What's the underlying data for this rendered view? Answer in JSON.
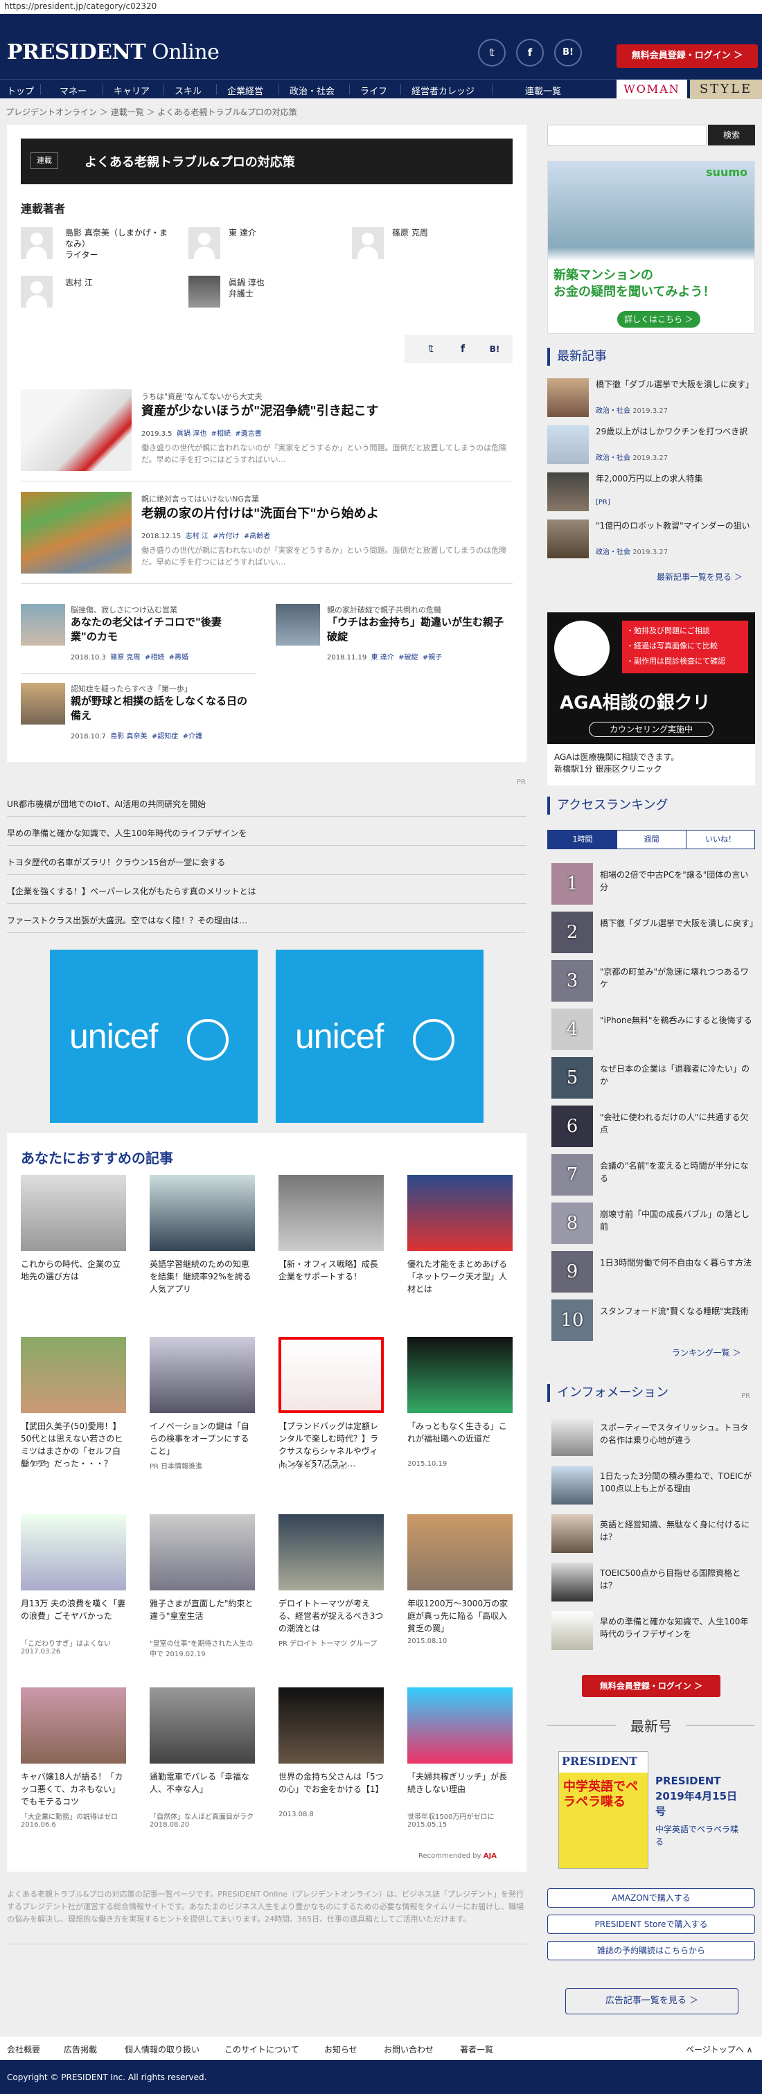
{
  "url": "https://president.jp/category/c02320",
  "header": {
    "logo_main": "PRESIDENT",
    "logo_sub": "Online",
    "social": [
      "twitter-icon",
      "facebook-icon",
      "hatena-icon"
    ],
    "social_labels": [
      "𝕥",
      "f",
      "B!"
    ],
    "register": "無料会員登録・ログイン ＞"
  },
  "nav": {
    "items": [
      "トップ",
      "マネー",
      "キャリア",
      "スキル",
      "企業経営",
      "政治・社会",
      "ライフ",
      "経営者カレッジ",
      "連載一覧"
    ],
    "woman": "WOMAN",
    "style": "STYLE"
  },
  "breadcrumb": [
    "プレジデントオンライン",
    "＞",
    "連載一覧",
    "＞",
    "よくある老親トラブル&プロの対応策"
  ],
  "page": {
    "tag": "連載",
    "title": "よくある老親トラブル&プロの対応策"
  },
  "authors_heading": "連載著者",
  "authors": [
    {
      "name": "島影 真奈美（しまかげ・まなみ）",
      "role": "ライター"
    },
    {
      "name": "東 達介",
      "role": ""
    },
    {
      "name": "篠原 克周",
      "role": ""
    },
    {
      "name": "志村 江",
      "role": ""
    },
    {
      "name": "眞鍋 淳也",
      "role": "弁護士"
    }
  ],
  "share": [
    "twitter-icon",
    "facebook-icon",
    "hatena-icon"
  ],
  "share_labels": [
    "𝕥",
    "f",
    "B!"
  ],
  "articles": [
    {
      "kicker": "うちは\"資産\"なんてないから大丈夫",
      "title": "資産が少ないほうが\"泥沼争続\"引き起こす",
      "date": "2019.3.5",
      "author": "眞鍋 淳也",
      "tags": [
        "#相続",
        "#遺言書"
      ],
      "excerpt": "働き盛りの世代が親に言われないのが「実家をどうするか」という問題。面倒だと放置してしまうのは危険だ。早めに手を打つにはどうすればいい…"
    },
    {
      "kicker": "親に絶対言ってはいけないNG言葉",
      "title": "老親の家の片付けは\"洗面台下\"から始めよ",
      "date": "2018.12.15",
      "author": "志村 江",
      "tags": [
        "#片付け",
        "#高齢者"
      ],
      "excerpt": "働き盛りの世代が親に言われないのが「実家をどうするか」という問題。面倒だと放置してしまうのは危険だ。早めに手を打つにはどうすればいい…"
    },
    {
      "kicker": "脳挫傷、寂しさにつけ込む営業",
      "title": "あなたの老父はイチコロで\"後妻業\"のカモ",
      "date": "2018.10.3",
      "author": "篠原 克周",
      "tags": [
        "#相続",
        "#再婚"
      ]
    },
    {
      "kicker": "親の家計破綻で親子共倒れの危機",
      "title": "「ウチはお金持ち」勘違いが生む親子破綻",
      "date": "2018.11.19",
      "author": "東 達介",
      "tags": [
        "#破綻",
        "#親子"
      ]
    },
    {
      "kicker": "認知症を疑ったらすべき「第一歩」",
      "title": "親が野球と相撲の話をしなくなる日の備え",
      "date": "2018.10.7",
      "author": "島影 真奈美",
      "tags": [
        "#認知症",
        "#介護"
      ]
    }
  ],
  "pr_label": "PR",
  "pr_links": [
    "UR都市機構が団地でのIoT、AI活用の共同研究を開始",
    "早めの準備と確かな知識で、人生100年時代のライフデザインを",
    "トヨタ歴代の名車がズラリ！クラウン15台が一堂に会する",
    "【企業を強くする！】ペーパーレス化がもたらす真のメリットとは",
    "ファーストクラス出張が大盛況。空ではなく陸！？その理由は…"
  ],
  "unicef": "unicef",
  "recommend": {
    "heading": "あなたにおすすめの記事",
    "footer": "Recommended by",
    "items": [
      {
        "title": "これからの時代、企業の立地先の選び方は",
        "sub": ""
      },
      {
        "title": "英語学習継続のための知恵を結集！継続率92%を誇る人気アプリ",
        "sub": ""
      },
      {
        "title": "【新・オフィス戦略】成長企業をサポートする！",
        "sub": ""
      },
      {
        "title": "優れた才能をまとめあげる「ネットワーク天才型」人材とは",
        "sub": ""
      },
      {
        "title": "【武田久美子(50)愛用！】50代とは思えない若さのヒミツはまさかの「セルフ白髪ケア」だった・・・？",
        "sub": "PR LPLP"
      },
      {
        "title": "イノベーションの鍵は「自らの検事をオープンにすること」",
        "sub": "PR 日本情報推進"
      },
      {
        "title": "【ブランドバッグは定額レンタルで楽しむ時代？】ラクサスならシャネルやヴィトンなど57ブラン…",
        "sub": "PR ラクサス（Laxus）"
      },
      {
        "title": "「みっともなく生きる」これが福祉職への近道だ",
        "sub": "2015.10.19"
      },
      {
        "title": "月13万 夫の浪費を嘆く「妻の浪費」ごそヤバかった",
        "sub": "「こだわりすぎ」はよくない 2017.03.26"
      },
      {
        "title": "雅子さまが直面した\"約束と違う\"皇室生活",
        "sub": "\"皇室の仕事\"を期待された人生の中で 2019.02.19"
      },
      {
        "title": "デロイトトーマツが考える、経営者が捉えるべき3つの潮流とは",
        "sub": "PR デロイト トーマツ グループ"
      },
      {
        "title": "年収1200万～3000万の家庭が真っ先に陥る「高収入貧乏の罠」",
        "sub": "2015.08.10"
      },
      {
        "title": "キャバ嬢18人が語る！「カッコ悪くて、カネもない」でもモテるコツ",
        "sub": "「大企業に勤務」の説得はゼロ 2016.06.6"
      },
      {
        "title": "通勤電車でバレる「幸福な人、不幸な人」",
        "sub": "「自然体」な人ほど真面目がラク 2018.08.20"
      },
      {
        "title": "世界の金持ち父さんは「5つの心」でお金をかける【1】",
        "sub": "2013.08.8"
      },
      {
        "title": "「夫婦共稼ぎリッチ」が長続きしない理由",
        "sub": "世帯年収1500万円がゼロに 2015.05.15"
      }
    ]
  },
  "description": "よくある老親トラブル&プロの対応策の記事一覧ページです。PRESIDENT Online（プレジデントオンライン）は、ビジネス誌「プレジデント」を発行するプレジデント社が運営する総合情報サイトです。あなたまのビジネス人生をより豊かなものにするための必要な情報をタイムリーにお届けし、職場の悩みを解決し、理想的な働き方を実現するヒントを提供してまいります。24時間、365日、仕事の道具箱としてご活用いただけます。",
  "sidebar": {
    "search_button": "検索",
    "ad_suumo": {
      "brand": "suumo",
      "line1": "新築マンションの",
      "line2": "お金の疑問を聞いてみよう！",
      "cta": "詳しくはこちら ＞"
    },
    "latest_heading": "最新記事",
    "latest": [
      {
        "title": "橋下徹「ダブル選挙で大阪を潰しに戻す」",
        "cat": "政治・社会",
        "date": "2019.3.27"
      },
      {
        "title": "29歳以上がはしかワクチンを打つべき訳",
        "cat": "政治・社会",
        "date": "2019.3.27"
      },
      {
        "title": "年2,000万円以上の求人特集",
        "cat": "[PR]",
        "date": ""
      },
      {
        "title": "\"1億円のロボット教習\"マインダーの狙い",
        "cat": "政治・社会",
        "date": "2019.3.27"
      }
    ],
    "latest_more": "最新記事一覧を見る ＞",
    "ad_aga": {
      "points": [
        "・勉排及び問題にご相談",
        "・経過は写真画像にて比較",
        "・副作用は問診検査にて確認"
      ],
      "title": "AGA相談の銀クリ",
      "sub": "カウンセリング実施中",
      "foot1": "AGAは医療機関に相談できます。",
      "foot2": "新橋駅1分 銀座区クリニック"
    },
    "ranking_heading": "アクセスランキング",
    "ranking_tabs": [
      "1時間",
      "週間",
      "いいね！"
    ],
    "ranking": [
      "相場の2倍で中古PCを\"譲る\"団体の言い分",
      "橋下徹「ダブル選挙で大阪を潰しに戻す」",
      "\"京都の町並み\"が急速に壊れつつあるワケ",
      "\"iPhone無料\"を鵜呑みにすると後悔する",
      "なぜ日本の企業は「退職者に冷たい」のか",
      "\"会社に使われるだけの人\"に共通する欠点",
      "会議の\"名前\"を変えると時間が半分になる",
      "崩壊寸前「中国の成長バブル」の落とし前",
      "1日3時間労働で何不自由なく暮らす方法",
      "スタンフォード流\"賢くなる睡眠\"実践術"
    ],
    "ranking_nums": [
      "1",
      "2",
      "3",
      "4",
      "5",
      "6",
      "7",
      "8",
      "9",
      "10"
    ],
    "ranking_more": "ランキング一覧 ＞",
    "info_heading": "インフォメーション",
    "info_pr": "PR",
    "info": [
      "スポーティーでスタイリッシュ。トヨタの名作は乗り心地が違う",
      "1日たった3分間の積み重ねで、TOEICが100点以上も上がる理由",
      "英語と経営知識、無駄なく身に付けるには？",
      "TOEIC500点から目指せる国際資格とは？",
      "早めの準備と確かな知識で、人生100年時代のライフデザインを"
    ],
    "register2": "無料会員登録・ログイン ＞",
    "newest_heading": "最新号",
    "magazine": {
      "brand": "PRESIDENT",
      "cover_text": "中学英語でペラペラ喋る",
      "title": "PRESIDENT 2019年4月15日号",
      "sub": "中学英語でペラペラ喋る"
    },
    "buy_buttons": [
      "AMAZONで購入する",
      "PRESIDENT Storeで購入する",
      "雑誌の予約購読はこちらから"
    ],
    "ads_more": "広告記事一覧を見る ＞"
  },
  "footer": {
    "links": [
      "会社概要",
      "広告掲載",
      "個人情報の取り扱い",
      "このサイトについて",
      "お知らせ",
      "お問い合わせ",
      "著者一覧"
    ],
    "pagetop": "ページトップへ ∧",
    "copyright": "Copyright © PRESIDENT Inc. All rights reserved."
  }
}
